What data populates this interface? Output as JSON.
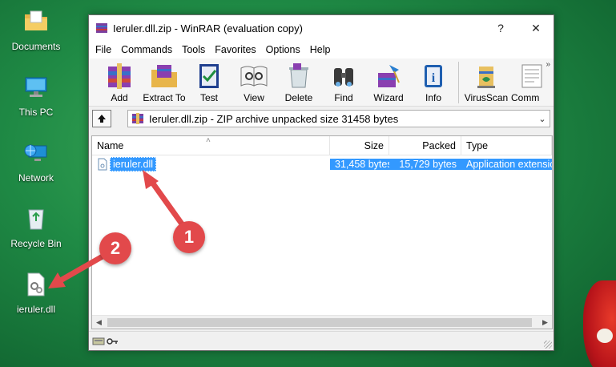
{
  "desktop": {
    "icons": [
      {
        "label": "Documents"
      },
      {
        "label": "This PC"
      },
      {
        "label": "Network"
      },
      {
        "label": "Recycle Bin"
      },
      {
        "label": "ieruler.dll"
      }
    ]
  },
  "window": {
    "title": "Ieruler.dll.zip - WinRAR (evaluation copy)",
    "help_button": "?",
    "close_button": "✕",
    "menu": [
      "File",
      "Commands",
      "Tools",
      "Favorites",
      "Options",
      "Help"
    ],
    "toolbar": [
      "Add",
      "Extract To",
      "Test",
      "View",
      "Delete",
      "Find",
      "Wizard",
      "Info",
      "VirusScan",
      "Comm"
    ],
    "toolbar_more": "»",
    "address": "Ieruler.dll.zip - ZIP archive unpacked size 31458 bytes",
    "columns": {
      "name": "Name",
      "size": "Size",
      "packed": "Packed",
      "type": "Type"
    },
    "rows": [
      {
        "name": "ieruler.dll",
        "size": "31,458 bytes",
        "packed": "15,729 bytes",
        "type": "Application extension",
        "selected": true
      }
    ]
  },
  "callouts": [
    "1",
    "2"
  ],
  "colors": {
    "accent": "#3399ff",
    "callout": "#e2494b",
    "desktop": "#1f8a45"
  }
}
